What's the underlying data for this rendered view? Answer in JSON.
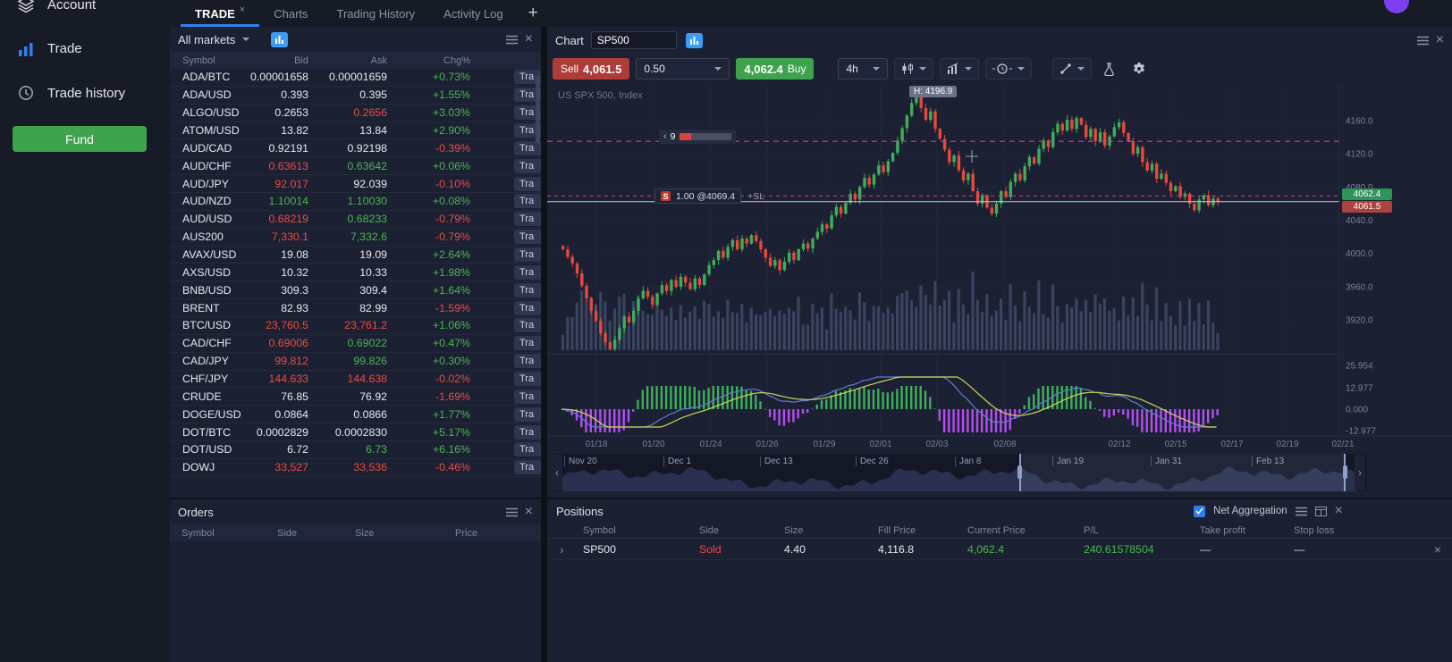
{
  "icons": {
    "close": "×",
    "chevron_left": "‹",
    "chevron_right": "›"
  },
  "app": {
    "tabs": [
      {
        "label": "TRADE",
        "active": true,
        "closable": true
      },
      {
        "label": "Charts",
        "active": false
      },
      {
        "label": "Trading History",
        "active": false
      },
      {
        "label": "Activity Log",
        "active": false
      }
    ],
    "add_tab_label": "+"
  },
  "sidebar": {
    "items": [
      {
        "label": "Account",
        "icon": "layers-icon"
      },
      {
        "label": "Trade",
        "icon": "bar-chart-icon",
        "active": true
      },
      {
        "label": "Trade history",
        "icon": "clock-icon"
      }
    ],
    "fund_button": "Fund"
  },
  "market_watch": {
    "title": "All markets",
    "columns": [
      "Symbol",
      "Bid",
      "Ask",
      "Chg%"
    ],
    "row_action_label": "Tra",
    "rows": [
      {
        "s": "ADA/BTC",
        "b": "0.00001658",
        "a": "0.00001659",
        "c": "+0.73%",
        "bc": "w",
        "ac": "w",
        "cc": "u"
      },
      {
        "s": "ADA/USD",
        "b": "0.393",
        "a": "0.395",
        "c": "+1.55%",
        "bc": "w",
        "ac": "w",
        "cc": "u"
      },
      {
        "s": "ALGO/USD",
        "b": "0.2653",
        "a": "0.2656",
        "c": "+3.03%",
        "bc": "w",
        "ac": "d",
        "cc": "u"
      },
      {
        "s": "ATOM/USD",
        "b": "13.82",
        "a": "13.84",
        "c": "+2.90%",
        "bc": "w",
        "ac": "w",
        "cc": "u"
      },
      {
        "s": "AUD/CAD",
        "b": "0.92191",
        "a": "0.92198",
        "c": "-0.39%",
        "bc": "w",
        "ac": "w",
        "cc": "d"
      },
      {
        "s": "AUD/CHF",
        "b": "0.63613",
        "a": "0.63642",
        "c": "+0.06%",
        "bc": "d",
        "ac": "u",
        "cc": "u"
      },
      {
        "s": "AUD/JPY",
        "b": "92.017",
        "a": "92.039",
        "c": "-0.10%",
        "bc": "d",
        "ac": "w",
        "cc": "d"
      },
      {
        "s": "AUD/NZD",
        "b": "1.10014",
        "a": "1.10030",
        "c": "+0.08%",
        "bc": "u",
        "ac": "u",
        "cc": "u"
      },
      {
        "s": "AUD/USD",
        "b": "0.68219",
        "a": "0.68233",
        "c": "-0.79%",
        "bc": "d",
        "ac": "u",
        "cc": "d"
      },
      {
        "s": "AUS200",
        "b": "7,330.1",
        "a": "7,332.6",
        "c": "-0.79%",
        "bc": "d",
        "ac": "u",
        "cc": "d"
      },
      {
        "s": "AVAX/USD",
        "b": "19.08",
        "a": "19.09",
        "c": "+2.64%",
        "bc": "w",
        "ac": "w",
        "cc": "u"
      },
      {
        "s": "AXS/USD",
        "b": "10.32",
        "a": "10.33",
        "c": "+1.98%",
        "bc": "w",
        "ac": "w",
        "cc": "u"
      },
      {
        "s": "BNB/USD",
        "b": "309.3",
        "a": "309.4",
        "c": "+1.64%",
        "bc": "w",
        "ac": "w",
        "cc": "u"
      },
      {
        "s": "BRENT",
        "b": "82.93",
        "a": "82.99",
        "c": "-1.59%",
        "bc": "w",
        "ac": "w",
        "cc": "d"
      },
      {
        "s": "BTC/USD",
        "b": "23,760.5",
        "a": "23,761.2",
        "c": "+1.06%",
        "bc": "d",
        "ac": "d",
        "cc": "u"
      },
      {
        "s": "CAD/CHF",
        "b": "0.69006",
        "a": "0.69022",
        "c": "+0.47%",
        "bc": "d",
        "ac": "u",
        "cc": "u"
      },
      {
        "s": "CAD/JPY",
        "b": "99.812",
        "a": "99.826",
        "c": "+0.30%",
        "bc": "d",
        "ac": "u",
        "cc": "u"
      },
      {
        "s": "CHF/JPY",
        "b": "144.633",
        "a": "144.638",
        "c": "-0.02%",
        "bc": "d",
        "ac": "d",
        "cc": "d"
      },
      {
        "s": "CRUDE",
        "b": "76.85",
        "a": "76.92",
        "c": "-1.69%",
        "bc": "w",
        "ac": "w",
        "cc": "d"
      },
      {
        "s": "DOGE/USD",
        "b": "0.0864",
        "a": "0.0866",
        "c": "+1.77%",
        "bc": "w",
        "ac": "w",
        "cc": "u"
      },
      {
        "s": "DOT/BTC",
        "b": "0.0002829",
        "a": "0.0002830",
        "c": "+5.17%",
        "bc": "w",
        "ac": "w",
        "cc": "u"
      },
      {
        "s": "DOT/USD",
        "b": "6.72",
        "a": "6.73",
        "c": "+6.16%",
        "bc": "w",
        "ac": "u",
        "cc": "u"
      },
      {
        "s": "DOWJ",
        "b": "33,527",
        "a": "33,536",
        "c": "-0.46%",
        "bc": "d",
        "ac": "d",
        "cc": "d"
      }
    ]
  },
  "orders": {
    "title": "Orders",
    "columns": [
      "Symbol",
      "Side",
      "Size",
      "Price"
    ]
  },
  "chart": {
    "panel_title": "Chart",
    "symbol_input": "SP500",
    "instrument_label": "US SPX 500, Index",
    "toolbar": {
      "sell_label": "Sell",
      "sell_price": "4,061.5",
      "quantity": "0.50",
      "buy_price": "4,062.4",
      "buy_label": "Buy",
      "timeframe": "4h"
    },
    "overlays": {
      "high_badge": "H: 4196.9",
      "bars_slider": "9",
      "position_side": "S",
      "position_text": "1.00 @4069.4",
      "sl_label": "+SL",
      "price_badge_buy": "4062.4",
      "price_badge_sell": "4061.5"
    },
    "price_axis": [
      "4160.0",
      "4120.0",
      "4080.0",
      "4040.0",
      "4000.0",
      "3960.0",
      "3920.0"
    ],
    "indicator_axis": [
      "25.954",
      "12.977",
      "0.000",
      "-12.977"
    ],
    "x_axis_labels": [
      "01/18",
      "01/20",
      "01/24",
      "01/26",
      "01/29",
      "02/01",
      "02/03",
      "02/08",
      "02/12",
      "02/15",
      "02/17",
      "02/19",
      "02/21"
    ],
    "navigator_labels": [
      "Nov 20",
      "Dec 1",
      "Dec 13",
      "Dec 26",
      "Jan 8",
      "Jan 19",
      "Jan 31",
      "Feb 13"
    ],
    "chart_data": {
      "type": "candlestick",
      "symbol": "SP500",
      "timeframe": "4h",
      "current_price": 4062.4,
      "session_high": 4196.9,
      "levels": {
        "alert_line": 4135.0,
        "position_entry": 4069.4,
        "bid": 4061.5,
        "ask": 4062.4
      },
      "closes": [
        4005,
        3996,
        3988,
        3976,
        3961,
        3946,
        3931,
        3919,
        3904,
        3893,
        3885,
        3896,
        3910,
        3924,
        3917,
        3931,
        3946,
        3955,
        3948,
        3938,
        3952,
        3962,
        3955,
        3968,
        3960,
        3972,
        3965,
        3957,
        3970,
        3962,
        3975,
        3986,
        3992,
        4003,
        3995,
        4008,
        4016,
        4005,
        4018,
        4012,
        4022,
        4015,
        4005,
        3995,
        3985,
        3992,
        3980,
        3990,
        4001,
        3992,
        4005,
        4012,
        4006,
        4018,
        4026,
        4035,
        4030,
        4046,
        4056,
        4048,
        4061,
        4072,
        4065,
        4080,
        4091,
        4083,
        4095,
        4106,
        4098,
        4111,
        4121,
        4136,
        4151,
        4166,
        4181,
        4193,
        4175,
        4161,
        4171,
        4150,
        4138,
        4125,
        4110,
        4118,
        4100,
        4088,
        4096,
        4075,
        4060,
        4070,
        4055,
        4048,
        4060,
        4075,
        4068,
        4086,
        4096,
        4088,
        4105,
        4116,
        4108,
        4126,
        4136,
        4128,
        4146,
        4156,
        4148,
        4161,
        4150,
        4163,
        4155,
        4140,
        4150,
        4135,
        4146,
        4130,
        4141,
        4152,
        4158,
        4145,
        4135,
        4120,
        4128,
        4110,
        4100,
        4108,
        4090,
        4096,
        4085,
        4075,
        4081,
        4068,
        4072,
        4060,
        4052,
        4065,
        4070,
        4058,
        4066,
        4062.4
      ]
    }
  },
  "positions": {
    "title": "Positions",
    "net_aggregation": {
      "label": "Net Aggregation",
      "checked": true
    },
    "columns": [
      "Symbol",
      "Side",
      "Size",
      "Fill Price",
      "Current Price",
      "P/L",
      "Take profit",
      "Stop loss"
    ],
    "rows": [
      {
        "symbol": "SP500",
        "side": "Sold",
        "size": "4.40",
        "fill_price": "4,116.8",
        "current_price": "4,062.4",
        "pl": "240.61578504",
        "take_profit": "—",
        "stop_loss": "—"
      }
    ]
  }
}
